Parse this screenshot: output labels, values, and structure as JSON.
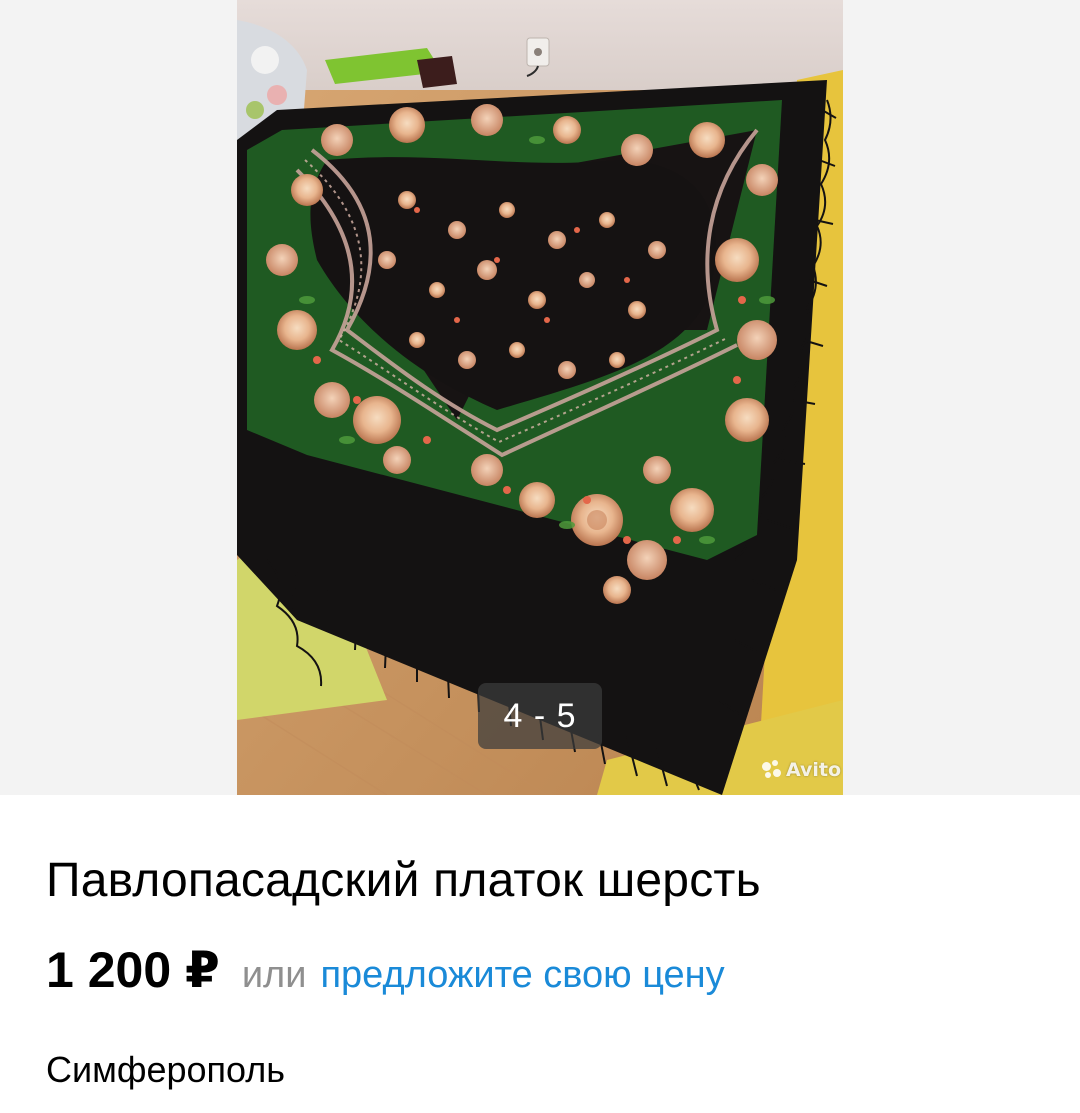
{
  "gallery": {
    "counter": "4 - 5",
    "watermark": "Avito",
    "image_subject": "shawl-on-bed"
  },
  "listing": {
    "title": "Павлопасадский платок шерсть",
    "price": "1 200 ₽",
    "price_or": "или",
    "offer_link": "предложите свою цену",
    "location": "Симферополь"
  },
  "colors": {
    "link": "#1a8ad8",
    "muted": "#8f8f8f",
    "shawl_black": "#141212",
    "shawl_green": "#1f5a22",
    "rose": "#e8b58e"
  }
}
